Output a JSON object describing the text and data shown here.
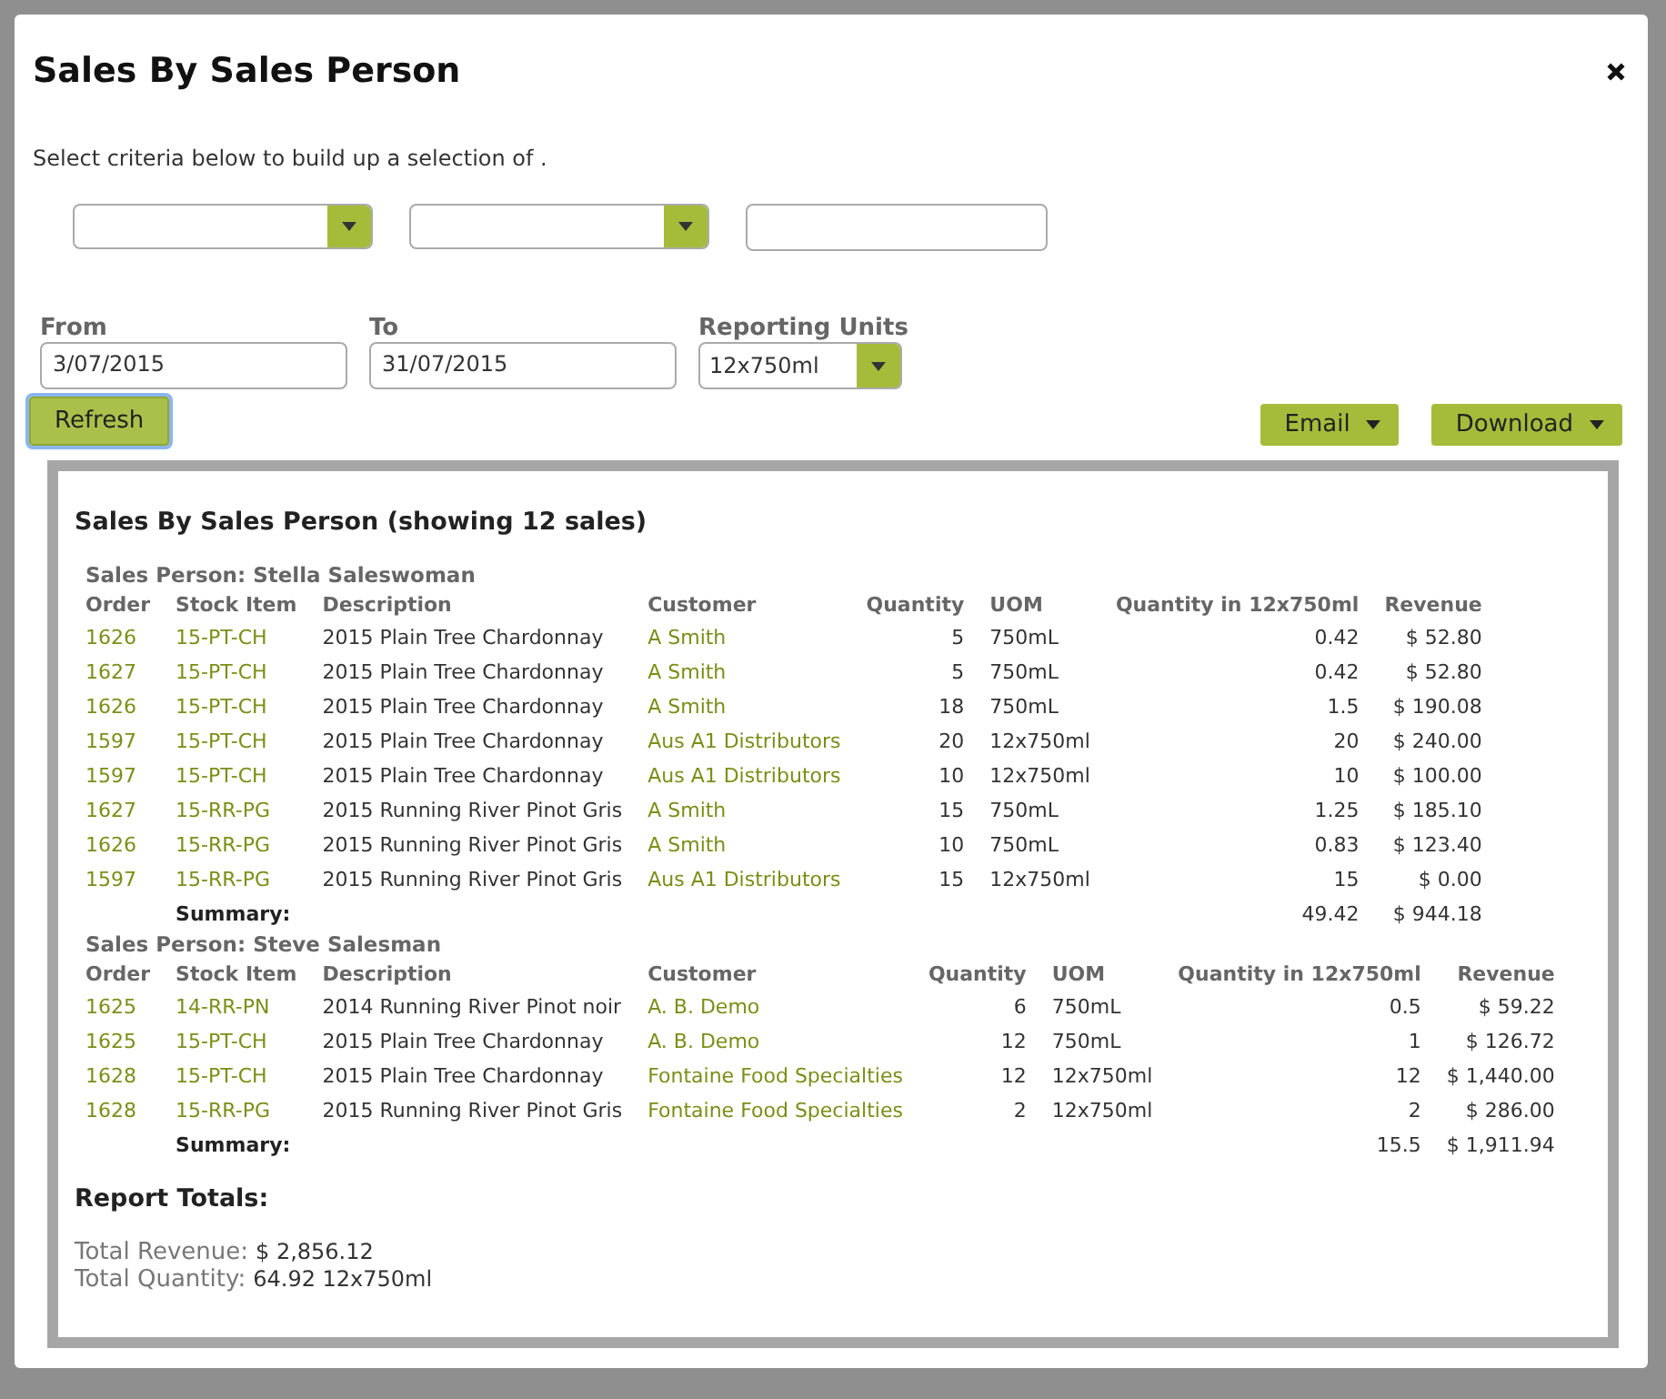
{
  "dialog": {
    "title": "Sales By Sales Person",
    "intro": "Select criteria below to build up a selection of .",
    "criteria": [
      {
        "kind": "dropdown"
      },
      {
        "kind": "dropdown"
      },
      {
        "kind": "text"
      }
    ],
    "filters": [
      {
        "label": "From",
        "kind": "text",
        "value": "3/07/2015"
      },
      {
        "label": "To",
        "kind": "text",
        "value": "31/07/2015"
      },
      {
        "label": "Reporting Units",
        "kind": "dropdown",
        "value": "12x750ml"
      }
    ],
    "refresh": {
      "label": "Refresh",
      "focused": true
    },
    "actions": [
      "Email",
      "Download"
    ]
  },
  "report": {
    "title": "Sales By Sales Person (showing 12 sales)",
    "groups": [
      {
        "heading": "Sales Person: Stella Saleswoman",
        "columns": [
          "Order",
          "Stock Item",
          "Description",
          "Customer",
          "Quantity",
          "UOM",
          "Quantity in 12x750ml",
          "Revenue"
        ],
        "rows": [
          {
            "order": "1626",
            "stock_item": "15-PT-CH",
            "description": "2015 Plain Tree Chardonnay",
            "customer": "A Smith",
            "quantity": "5",
            "uom": "750mL",
            "quantity_units": "0.42",
            "revenue": "$ 52.80"
          },
          {
            "order": "1627",
            "stock_item": "15-PT-CH",
            "description": "2015 Plain Tree Chardonnay",
            "customer": "A Smith",
            "quantity": "5",
            "uom": "750mL",
            "quantity_units": "0.42",
            "revenue": "$ 52.80"
          },
          {
            "order": "1626",
            "stock_item": "15-PT-CH",
            "description": "2015 Plain Tree Chardonnay",
            "customer": "A Smith",
            "quantity": "18",
            "uom": "750mL",
            "quantity_units": "1.5",
            "revenue": "$ 190.08"
          },
          {
            "order": "1597",
            "stock_item": "15-PT-CH",
            "description": "2015 Plain Tree Chardonnay",
            "customer": "Aus A1 Distributors",
            "quantity": "20",
            "uom": "12x750ml",
            "quantity_units": "20",
            "revenue": "$ 240.00"
          },
          {
            "order": "1597",
            "stock_item": "15-PT-CH",
            "description": "2015 Plain Tree Chardonnay",
            "customer": "Aus A1 Distributors",
            "quantity": "10",
            "uom": "12x750ml",
            "quantity_units": "10",
            "revenue": "$ 100.00"
          },
          {
            "order": "1627",
            "stock_item": "15-RR-PG",
            "description": "2015 Running River Pinot Gris",
            "customer": "A Smith",
            "quantity": "15",
            "uom": "750mL",
            "quantity_units": "1.25",
            "revenue": "$ 185.10"
          },
          {
            "order": "1626",
            "stock_item": "15-RR-PG",
            "description": "2015 Running River Pinot Gris",
            "customer": "A Smith",
            "quantity": "10",
            "uom": "750mL",
            "quantity_units": "0.83",
            "revenue": "$ 123.40"
          },
          {
            "order": "1597",
            "stock_item": "15-RR-PG",
            "description": "2015 Running River Pinot Gris",
            "customer": "Aus A1 Distributors",
            "quantity": "15",
            "uom": "12x750ml",
            "quantity_units": "15",
            "revenue": "$ 0.00"
          }
        ],
        "summary": {
          "label": "Summary:",
          "quantity_units": "49.42",
          "revenue": "$ 944.18"
        }
      },
      {
        "heading": "Sales Person: Steve Salesman",
        "columns": [
          "Order",
          "Stock Item",
          "Description",
          "Customer",
          "Quantity",
          "UOM",
          "Quantity in 12x750ml",
          "Revenue"
        ],
        "rows": [
          {
            "order": "1625",
            "stock_item": "14-RR-PN",
            "description": "2014 Running River Pinot noir",
            "customer": "A. B. Demo",
            "quantity": "6",
            "uom": "750mL",
            "quantity_units": "0.5",
            "revenue": "$ 59.22"
          },
          {
            "order": "1625",
            "stock_item": "15-PT-CH",
            "description": "2015 Plain Tree Chardonnay",
            "customer": "A. B. Demo",
            "quantity": "12",
            "uom": "750mL",
            "quantity_units": "1",
            "revenue": "$ 126.72"
          },
          {
            "order": "1628",
            "stock_item": "15-PT-CH",
            "description": "2015 Plain Tree Chardonnay",
            "customer": "Fontaine Food Specialties",
            "quantity": "12",
            "uom": "12x750ml",
            "quantity_units": "12",
            "revenue": "$ 1,440.00"
          },
          {
            "order": "1628",
            "stock_item": "15-RR-PG",
            "description": "2015 Running River Pinot Gris",
            "customer": "Fontaine Food Specialties",
            "quantity": "2",
            "uom": "12x750ml",
            "quantity_units": "2",
            "revenue": "$ 286.00"
          }
        ],
        "summary": {
          "label": "Summary:",
          "quantity_units": "15.5",
          "revenue": "$ 1,911.94"
        }
      }
    ],
    "totals_title": "Report Totals:",
    "totals": [
      {
        "label": "Total Revenue:",
        "value": "$ 2,856.12"
      },
      {
        "label": "Total Quantity:",
        "value": "64.92 12x750ml"
      }
    ]
  }
}
